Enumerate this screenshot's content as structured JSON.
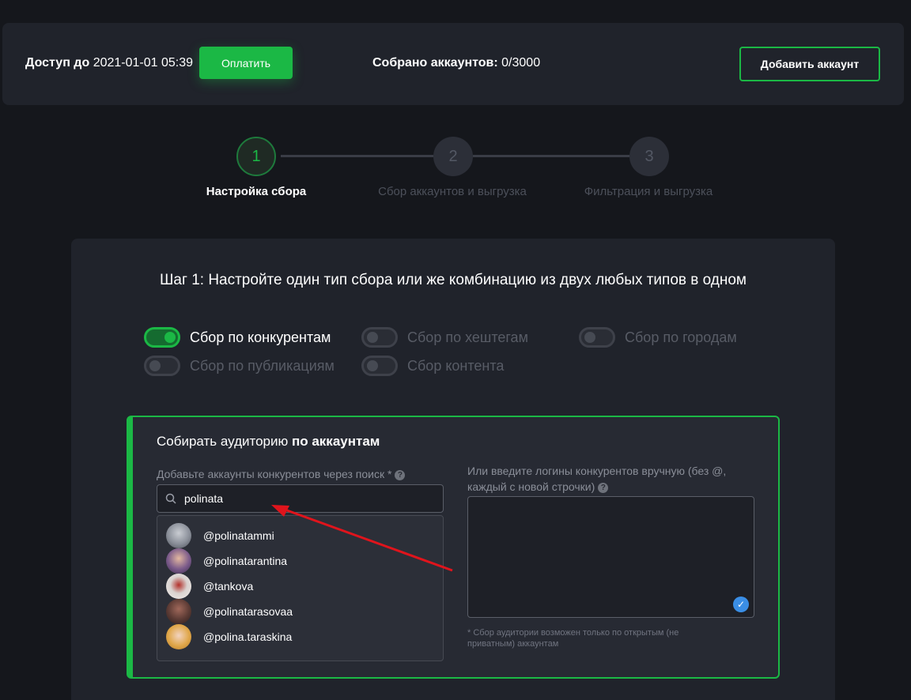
{
  "topbar": {
    "access_label": "Доступ до",
    "access_date": "2021-01-01 05:39",
    "pay_button": "Оплатить",
    "collected_label": "Собрано аккаунтов:",
    "collected_value": "0/3000",
    "add_button": "Добавить аккаунт"
  },
  "steps": [
    {
      "number": "1",
      "label": "Настройка сбора",
      "active": true
    },
    {
      "number": "2",
      "label": "Сбор аккаунтов и выгрузка",
      "active": false
    },
    {
      "number": "3",
      "label": "Фильтрация и выгрузка",
      "active": false
    }
  ],
  "panel": {
    "title": "Шаг 1: Настройте один тип сбора или же комбинацию из двух любых типов в одном",
    "toggles": [
      {
        "label": "Сбор по конкурентам",
        "on": true
      },
      {
        "label": "Сбор по хештегам",
        "on": false
      },
      {
        "label": "Сбор по городам",
        "on": false
      },
      {
        "label": "Сбор по публикациям",
        "on": false
      },
      {
        "label": "Сбор контента",
        "on": false
      }
    ]
  },
  "card": {
    "title_prefix": "Собирать аудиторию",
    "title_bold": "по аккаунтам",
    "search_label": "Добавьте аккаунты конкурентов через поиск *",
    "search_value": "polinata",
    "manual_label": "Или введите логины конкурентов вручную (без @, каждый с новой строчки)",
    "results": [
      {
        "handle": "@polinatammi",
        "avatar_color": "#8a8f99"
      },
      {
        "handle": "@polinatarantina",
        "avatar_color": "#7a5a8a"
      },
      {
        "handle": "@tankova",
        "avatar_color": "#d9d2cf"
      },
      {
        "handle": "@polinatarasovaa",
        "avatar_color": "#5a3a34"
      },
      {
        "handle": "@polina.taraskina",
        "avatar_color": "#e0a74a"
      }
    ],
    "note": "* Сбор аудитории возможен только по открытым (не приватным) аккаунтам"
  },
  "colors": {
    "accent": "#1bb845",
    "arrow": "#e0141c",
    "check": "#3a8ee6"
  },
  "icons": {
    "search": "search-icon",
    "help": "question-icon",
    "check": "check-circle-icon"
  }
}
